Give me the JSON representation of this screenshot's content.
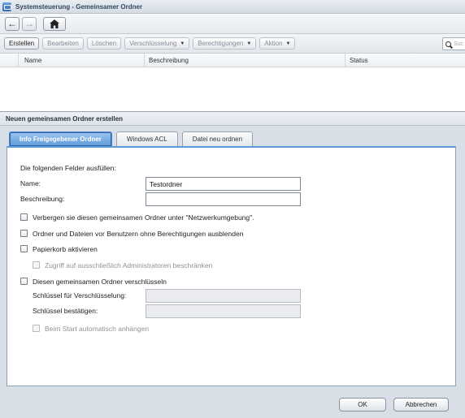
{
  "window": {
    "title": "Systemsteuerung - Gemeinsamer Ordner",
    "app_icon": "shared-folder-icon"
  },
  "nav": {
    "back_icon": "arrow-left-icon",
    "forward_icon": "arrow-right-icon",
    "home_icon": "home-icon"
  },
  "toolbar": {
    "create": "Erstellen",
    "edit": "Bearbeiten",
    "delete": "Löschen",
    "encryption": "Verschlüsselung",
    "permissions": "Berechtigungen",
    "action": "Aktion",
    "search_placeholder": "Suc"
  },
  "table": {
    "columns": [
      "Name",
      "Beschreibung",
      "Status"
    ]
  },
  "dialog": {
    "title": "Neuen gemeinsamen Ordner erstellen",
    "tabs": [
      "Info Freigegebener Ordner",
      "Windows ACL",
      "Datei neu ordnen"
    ],
    "active_tab": "Info Freigegebener Ordner",
    "instructions": "Die folgenden Felder ausfüllen:",
    "name_label": "Name:",
    "name_value": "Testordner",
    "description_label": "Beschreibung:",
    "description_value": "",
    "hide_network_label": "Verbergen sie diesen gemeinsamen Ordner unter \"Netzwerkumgebung\".",
    "hide_noperm_label": "Ordner und Dateien vor Benutzern ohne Berechtigungen ausblenden",
    "recycle_bin_label": "Papierkorb aktivieren",
    "recycle_admin_label": "Zugriff auf ausschließlich Administratoren beschränken",
    "encrypt_label": "Diesen gemeinsamen Ordner verschlüsseln",
    "key_label": "Schlüssel für Verschlüsselung:",
    "key_confirm_label": "Schlüssel bestätigen:",
    "automount_label": "Beim Start automatisch anhängen",
    "ok": "OK",
    "cancel": "Abbrechen"
  }
}
